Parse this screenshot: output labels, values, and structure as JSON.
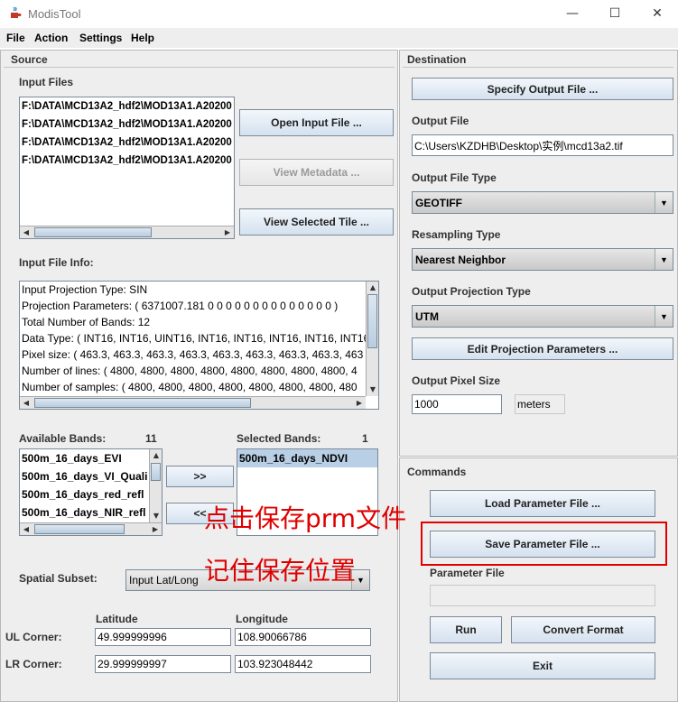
{
  "window": {
    "title": "ModisTool",
    "minimize": "—",
    "maximize": "☐",
    "close": "✕"
  },
  "menu": [
    "File",
    "Action",
    "Settings",
    "Help"
  ],
  "source": {
    "header": "Source",
    "input_files_label": "Input Files",
    "input_files": [
      "F:\\DATA\\MCD13A2_hdf2\\MOD13A1.A20200",
      "F:\\DATA\\MCD13A2_hdf2\\MOD13A1.A20200",
      "F:\\DATA\\MCD13A2_hdf2\\MOD13A1.A20200",
      "F:\\DATA\\MCD13A2_hdf2\\MOD13A1.A20200"
    ],
    "open_input": "Open Input File ...",
    "view_metadata": "View Metadata ...",
    "view_selected_tile": "View Selected Tile  ...",
    "input_info_label": "Input File Info:",
    "input_info_lines": [
      "Input Projection Type: SIN",
      "Projection Parameters: ( 6371007.181 0 0 0 0 0 0 0 0 0 0 0 0 0 0 )",
      "Total Number of Bands: 12",
      "Data Type: ( INT16, INT16, UINT16, INT16, INT16, INT16, INT16, INT16, I",
      "Pixel size: ( 463.3, 463.3, 463.3, 463.3, 463.3, 463.3, 463.3, 463.3, 463",
      "Number of lines: ( 4800, 4800, 4800, 4800, 4800, 4800, 4800, 4800, 4",
      "Number of samples: ( 4800, 4800, 4800, 4800, 4800, 4800, 4800, 480"
    ],
    "available_label": "Available Bands:",
    "available_count": "11",
    "available_bands": [
      "500m_16_days_EVI",
      "500m_16_days_VI_Quali",
      "500m_16_days_red_refl",
      "500m_16_days_NIR_refl"
    ],
    "add": ">>",
    "remove": "<<",
    "selected_label": "Selected Bands:",
    "selected_count": "1",
    "selected_bands": [
      "500m_16_days_NDVI"
    ],
    "spatial_label": "Spatial Subset:",
    "spatial_value": "Input Lat/Long",
    "lat_label": "Latitude",
    "lon_label": "Longitude",
    "ul_label": "UL Corner:",
    "lr_label": "LR Corner:",
    "ul_lat": "49.999999996",
    "ul_lon": "108.90066786",
    "lr_lat": "29.999999997",
    "lr_lon": "103.923048442"
  },
  "destination": {
    "header": "Destination",
    "specify_output": "Specify Output File ...",
    "output_file_label": "Output File",
    "output_file": "C:\\Users\\KZDHB\\Desktop\\实例\\mcd13a2.tif",
    "file_type_label": "Output File Type",
    "file_type": "GEOTIFF",
    "resampling_label": "Resampling Type",
    "resampling": "Nearest Neighbor",
    "projection_label": "Output Projection Type",
    "projection": "UTM",
    "edit_projection": "Edit Projection Parameters ...",
    "pixel_size_label": "Output Pixel Size",
    "pixel_size": "1000",
    "pixel_unit": "meters"
  },
  "commands": {
    "header": "Commands",
    "load_param": "Load Parameter File ...",
    "save_param": "Save Parameter File ...",
    "param_file_label": "Parameter File",
    "param_file": "",
    "run": "Run",
    "convert": "Convert Format",
    "exit": "Exit"
  },
  "annotations": {
    "line1": "点击保存prm文件",
    "line2": "记住保存位置",
    "color": "#e00000"
  }
}
